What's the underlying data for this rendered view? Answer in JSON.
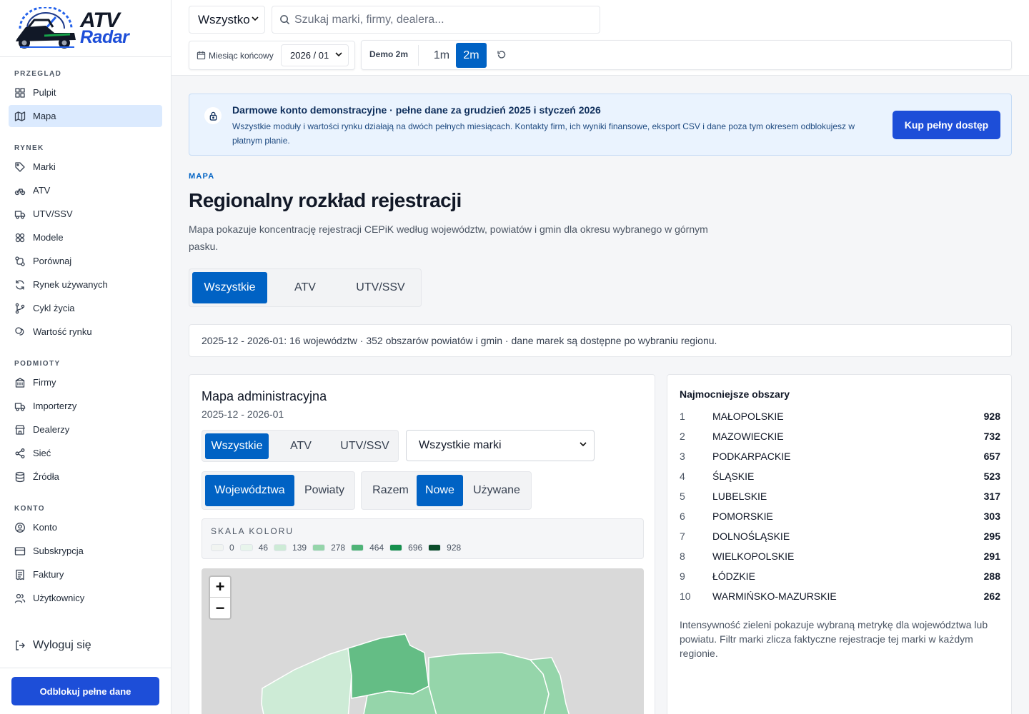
{
  "brand": {
    "line1": "ATV",
    "line2": "Radar"
  },
  "sidebar": {
    "sections": [
      {
        "label": "PRZEGLĄD",
        "items": [
          {
            "label": "Pulpit",
            "icon": "dashboard-icon"
          },
          {
            "label": "Mapa",
            "icon": "map-icon",
            "active": true
          }
        ]
      },
      {
        "label": "RYNEK",
        "items": [
          {
            "label": "Marki",
            "icon": "tag-icon"
          },
          {
            "label": "ATV",
            "icon": "bike-icon"
          },
          {
            "label": "UTV/SSV",
            "icon": "truck-icon"
          },
          {
            "label": "Modele",
            "icon": "cubes-icon"
          },
          {
            "label": "Porównaj",
            "icon": "compare-icon"
          },
          {
            "label": "Rynek używanych",
            "icon": "refresh-icon"
          },
          {
            "label": "Cykl życia",
            "icon": "branch-icon"
          },
          {
            "label": "Wartość rynku",
            "icon": "coins-icon"
          }
        ]
      },
      {
        "label": "PODMIOTY",
        "items": [
          {
            "label": "Firmy",
            "icon": "building-icon"
          },
          {
            "label": "Importerzy",
            "icon": "truck-icon"
          },
          {
            "label": "Dealerzy",
            "icon": "store-icon"
          },
          {
            "label": "Sieć",
            "icon": "share-icon"
          },
          {
            "label": "Źródła",
            "icon": "database-icon"
          }
        ]
      },
      {
        "label": "KONTO",
        "items": [
          {
            "label": "Konto",
            "icon": "user-circle-icon"
          },
          {
            "label": "Subskrypcja",
            "icon": "card-icon"
          },
          {
            "label": "Faktury",
            "icon": "receipt-icon"
          },
          {
            "label": "Użytkownicy",
            "icon": "users-icon"
          }
        ]
      }
    ],
    "logout": "Wyloguj się",
    "unlock": "Odblokuj pełne dane"
  },
  "topbar": {
    "type_select": "Wszystko",
    "search_placeholder": "Szukaj marki, firmy, dealera...",
    "month_label": "Miesiąc końcowy",
    "month_value": "2026 / 01",
    "demo_label": "Demo 2m",
    "range_1m": "1m",
    "range_2m": "2m"
  },
  "banner": {
    "title": "Darmowe konto demonstracyjne · pełne dane za grudzień 2025 i styczeń 2026",
    "text": "Wszystkie moduły i wartości rynku działają na dwóch pełnych miesiącach. Kontakty firm, ich wyniki finansowe, eksport CSV i dane poza tym okresem odblokujesz w płatnym planie.",
    "button": "Kup pełny dostęp"
  },
  "page": {
    "kicker": "MAPA",
    "title": "Regionalny rozkład rejestracji",
    "description": "Mapa pokazuje koncentrację rejestracji CEPiK według województw, powiatów i gmin dla okresu wybranego w górnym pasku.",
    "tabs": [
      "Wszystkie",
      "ATV",
      "UTV/SSV"
    ],
    "info": "2025-12 - 2026-01: 16 województw · 352 obszarów powiatów i gmin · dane marek są dostępne po wybraniu regionu."
  },
  "map_card": {
    "title": "Mapa administracyjna",
    "period": "2025-12 - 2026-01",
    "vehicle_tabs": [
      "Wszystkie",
      "ATV",
      "UTV/SSV"
    ],
    "brand_select": "Wszystkie marki",
    "level_tabs": [
      "Województwa",
      "Powiaty"
    ],
    "status_tabs": [
      "Razem",
      "Nowe",
      "Używane"
    ],
    "scale_title": "SKALA KOLORU",
    "scale": [
      {
        "value": "0",
        "color": "#f1f4f1"
      },
      {
        "value": "46",
        "color": "#e8f5ec"
      },
      {
        "value": "139",
        "color": "#cdebd6"
      },
      {
        "value": "278",
        "color": "#95d5aa"
      },
      {
        "value": "464",
        "color": "#4fb477"
      },
      {
        "value": "696",
        "color": "#16904d"
      },
      {
        "value": "928",
        "color": "#0b4d2a"
      }
    ],
    "zoom_in": "+",
    "zoom_out": "−"
  },
  "top_areas": {
    "title": "Najmocniejsze obszary",
    "rows": [
      {
        "rank": "1",
        "name": "MAŁOPOLSKIE",
        "value": "928"
      },
      {
        "rank": "2",
        "name": "MAZOWIECKIE",
        "value": "732"
      },
      {
        "rank": "3",
        "name": "PODKARPACKIE",
        "value": "657"
      },
      {
        "rank": "4",
        "name": "ŚLĄSKIE",
        "value": "523"
      },
      {
        "rank": "5",
        "name": "LUBELSKIE",
        "value": "317"
      },
      {
        "rank": "6",
        "name": "POMORSKIE",
        "value": "303"
      },
      {
        "rank": "7",
        "name": "DOLNOŚLĄSKIE",
        "value": "295"
      },
      {
        "rank": "8",
        "name": "WIELKOPOLSKIE",
        "value": "291"
      },
      {
        "rank": "9",
        "name": "ŁÓDZKIE",
        "value": "288"
      },
      {
        "rank": "10",
        "name": "WARMIŃSKO-MAZURSKIE",
        "value": "262"
      }
    ],
    "note": "Intensywność zieleni pokazuje wybraną metrykę dla województwa lub powiatu. Filtr marki zlicza faktyczne rejestracje tej marki w każdym regionie."
  }
}
